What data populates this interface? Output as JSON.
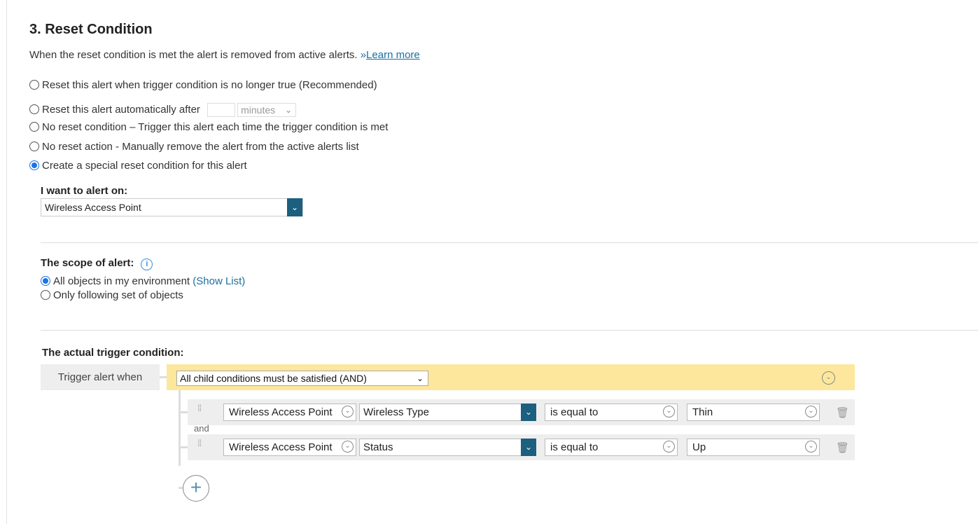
{
  "section": {
    "title": "3. Reset Condition",
    "description": "When the reset condition is met the alert is removed from active alerts. ",
    "learn_more_prefix": "»",
    "learn_more": "Learn more"
  },
  "reset_options": [
    {
      "label": "Reset this alert when trigger condition is no longer true (Recommended)",
      "checked": false
    },
    {
      "label": "Reset this alert automatically after",
      "checked": false
    },
    {
      "label": "No reset condition – Trigger this alert each time the trigger condition is met",
      "checked": false
    },
    {
      "label": "No reset action - Manually remove the alert from the active alerts list",
      "checked": false
    },
    {
      "label": "Create a special reset condition for this alert",
      "checked": true
    }
  ],
  "auto_reset": {
    "value": "",
    "unit": "minutes"
  },
  "alert_on": {
    "label": "I want to alert on:",
    "value": "Wireless Access Point"
  },
  "scope": {
    "label": "The scope of alert:",
    "options": [
      {
        "label": "All objects in my environment",
        "checked": true
      },
      {
        "label": "Only following set of objects",
        "checked": false
      }
    ],
    "show_list": "(Show List)"
  },
  "trigger": {
    "heading": "The actual trigger condition:",
    "when_label": "Trigger alert when",
    "logic": "All child conditions must be satisfied (AND)",
    "joiner": "and",
    "conditions": [
      {
        "object": "Wireless Access Point",
        "property": "Wireless Type",
        "operator": "is equal to",
        "value": "Thin"
      },
      {
        "object": "Wireless Access Point",
        "property": "Status",
        "operator": "is equal to",
        "value": "Up"
      }
    ]
  },
  "colors": {
    "accent": "#1c5f7e",
    "condition_bar": "#fde79c",
    "link": "#1a6fa0"
  }
}
